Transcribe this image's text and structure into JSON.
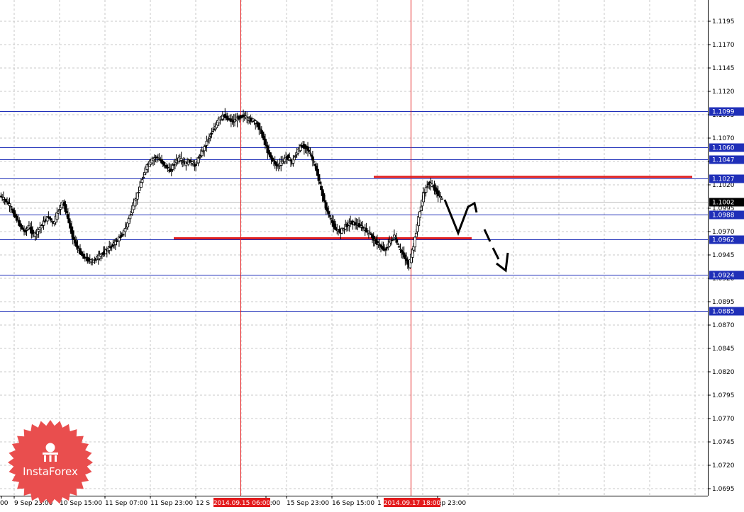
{
  "chart_data": {
    "type": "candlestick",
    "price_axis": {
      "labels": [
        "1.1195",
        "1.1170",
        "1.1145",
        "1.1120",
        "1.1095",
        "1.1070",
        "1.1045",
        "1.1020",
        "1.0995",
        "1.0970",
        "1.0945",
        "1.0920",
        "1.0895",
        "1.0870",
        "1.0845",
        "1.0820",
        "1.0795",
        "1.0770",
        "1.0745",
        "1.0720",
        "1.0695"
      ],
      "range": [
        1.0685,
        1.1222
      ]
    },
    "time_axis": {
      "labels": [
        "00",
        "9 Sep 23:00",
        "10 Sep 15:00",
        "11 Sep 07:00",
        "11 Sep 23:00",
        "12 S",
        "7:00",
        "15 Sep 23:00",
        "16 Sep 15:00",
        "1",
        "ep 23:00"
      ]
    },
    "current_price": {
      "label": "1.1002",
      "value": 1.1002,
      "color": "#000000"
    },
    "horizontal_levels": [
      {
        "label": "1.1099",
        "value": 1.1099
      },
      {
        "label": "1.1060",
        "value": 1.106
      },
      {
        "label": "1.1047",
        "value": 1.1047
      },
      {
        "label": "1.1027",
        "value": 1.1027
      },
      {
        "label": "1.0988",
        "value": 1.0988
      },
      {
        "label": "1.0962",
        "value": 1.0962
      },
      {
        "label": "1.0924",
        "value": 1.0924
      },
      {
        "label": "1.0885",
        "value": 1.0885
      }
    ],
    "vertical_markers": [
      {
        "label": "2014.09.15 06:00",
        "color": "#e31a1c"
      },
      {
        "label": "2014.09.17 18:00",
        "color": "#e31a1c"
      }
    ],
    "resistance_zone": {
      "value": 1.1027,
      "color": "#e02020"
    },
    "support_zone": {
      "value": 1.0962,
      "color": "#e02020"
    },
    "close_series": [
      1.1004,
      1.0998,
      1.0988,
      1.0978,
      1.097,
      1.0975,
      1.0966,
      1.0972,
      1.098,
      1.0986,
      1.0978,
      1.0992,
      1.1002,
      1.0984,
      1.0964,
      1.0952,
      1.0944,
      1.094,
      1.0938,
      1.0942,
      1.0946,
      1.095,
      1.0955,
      1.096,
      1.0966,
      1.0975,
      1.0992,
      1.1006,
      1.1022,
      1.1038,
      1.1045,
      1.105,
      1.1046,
      1.104,
      1.1035,
      1.1045,
      1.1048,
      1.1042,
      1.1046,
      1.104,
      1.105,
      1.106,
      1.1072,
      1.108,
      1.109,
      1.1094,
      1.109,
      1.1088,
      1.1092,
      1.1094,
      1.109,
      1.1089,
      1.1084,
      1.1072,
      1.1056,
      1.1046,
      1.104,
      1.1045,
      1.105,
      1.1044,
      1.1055,
      1.1062,
      1.106,
      1.105,
      1.1036,
      1.1014,
      1.0995,
      1.0982,
      1.0972,
      1.097,
      1.0976,
      1.098,
      1.0978,
      1.0976,
      1.0972,
      1.0968,
      1.096,
      1.0955,
      1.095,
      1.0958,
      1.0965,
      1.0952,
      1.0944,
      1.0933,
      1.0955,
      1.0985,
      1.101,
      1.1022,
      1.1018,
      1.101,
      1.1002
    ],
    "projection_color": "#000000"
  },
  "logo": {
    "text": "InstaForex",
    "color": "#e94e4e"
  }
}
